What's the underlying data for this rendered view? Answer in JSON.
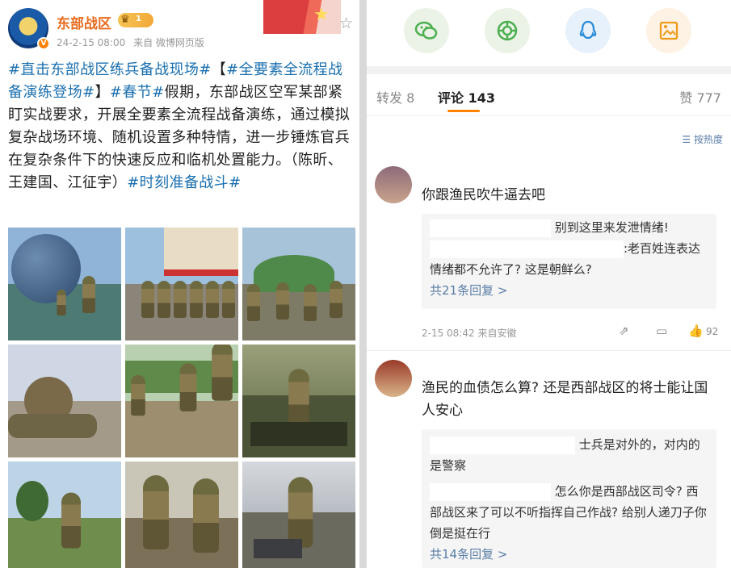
{
  "post": {
    "username": "东部战区",
    "level_badge": "1",
    "timestamp": "24-2-15 08:00",
    "source": "来自 微博网页版",
    "body": [
      {
        "text": "#直击东部战区练兵备战现场#",
        "tag": true
      },
      {
        "text": "【",
        "tag": false
      },
      {
        "text": "#全要素全流程战备演练登场#",
        "tag": true
      },
      {
        "text": "】",
        "tag": false
      },
      {
        "text": "#春节#",
        "tag": true
      },
      {
        "text": "假期，东部战区空军某部紧盯实战要求，开展全要素全流程战备演练，通过模拟复杂战场环境、随机设置多种特情，进一步锤炼官兵在复杂条件下的快速反应和临机处置能力。（陈昕、王建国、江征宇）",
        "tag": false
      },
      {
        "text": "#时刻准备战斗#",
        "tag": true
      }
    ],
    "photo_count": 9
  },
  "share_icons": [
    "wechat-icon",
    "moments-icon",
    "qq-icon",
    "save-image-icon"
  ],
  "tabs": {
    "repost": "转发 8",
    "comments": "评论 143",
    "likes": "赞 777"
  },
  "sort_label": "按热度",
  "comments": [
    {
      "text": "你跟渔民吹牛逼去吧",
      "replies": [
        "别到这里来发泄情绪!",
        ":老百姓连表达情绪都不允许了? 这是朝鲜么?"
      ],
      "more_replies": "共21条回复 >",
      "time": "2-15 08:42",
      "location": "来自安徽",
      "like_count": "92"
    },
    {
      "text": "渔民的血债怎么算? 还是西部战区的将士能让国人安心",
      "replies": [
        "士兵是对外的，对内的是警察",
        "怎么你是西部战区司令? 西部战区来了可以不听指挥自己作战? 给别人递刀子你倒是挺在行"
      ],
      "more_replies": "共14条回复 >"
    }
  ],
  "colors": {
    "username": "#e86c1f",
    "hashtag": "#1a6fb0",
    "link": "#5b7ea8",
    "tab_underline": "#ff8200"
  }
}
